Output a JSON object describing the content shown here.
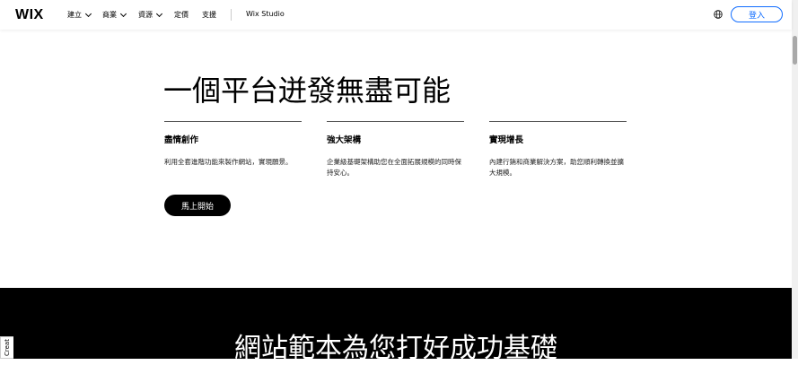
{
  "nav": {
    "logo": "WIX",
    "items": [
      {
        "label": "建立"
      },
      {
        "label": "商業"
      },
      {
        "label": "資源"
      },
      {
        "label": "定價"
      },
      {
        "label": "支援"
      }
    ],
    "studio": "Wix Studio",
    "login": "登入",
    "globe_icon": "globe-icon"
  },
  "hero": {
    "title": "一個平台迸發無盡可能",
    "features": [
      {
        "title": "盡情創作",
        "desc": "利用全套進階功能來製作網站，實現願景。"
      },
      {
        "title": "強大架構",
        "desc": "企業級基礎架構助您在全面拓展規模的同時保持安心。"
      },
      {
        "title": "實現增長",
        "desc": "內建行銷和商業解決方案，助您順利轉換並擴大規模。"
      }
    ],
    "cta": "馬上開始"
  },
  "templates": {
    "title": "網站範本為您打好成功基礎"
  },
  "side_tab": "Creat"
}
